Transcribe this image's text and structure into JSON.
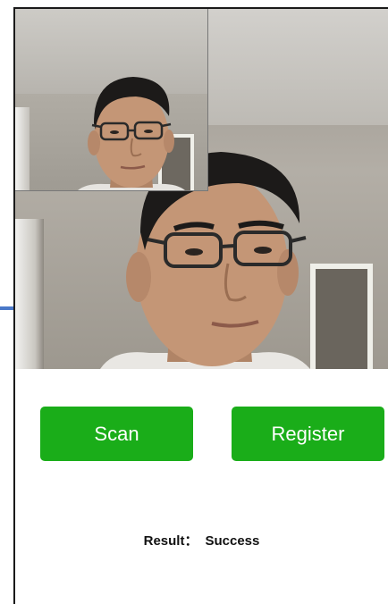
{
  "buttons": {
    "scan_label": "Scan",
    "register_label": "Register"
  },
  "result": {
    "label": "Result：",
    "value": "Success"
  },
  "colors": {
    "button_bg": "#1aad19",
    "button_text": "#ffffff",
    "frame": "#1a1a1a",
    "side_marker": "#4a78c8"
  }
}
